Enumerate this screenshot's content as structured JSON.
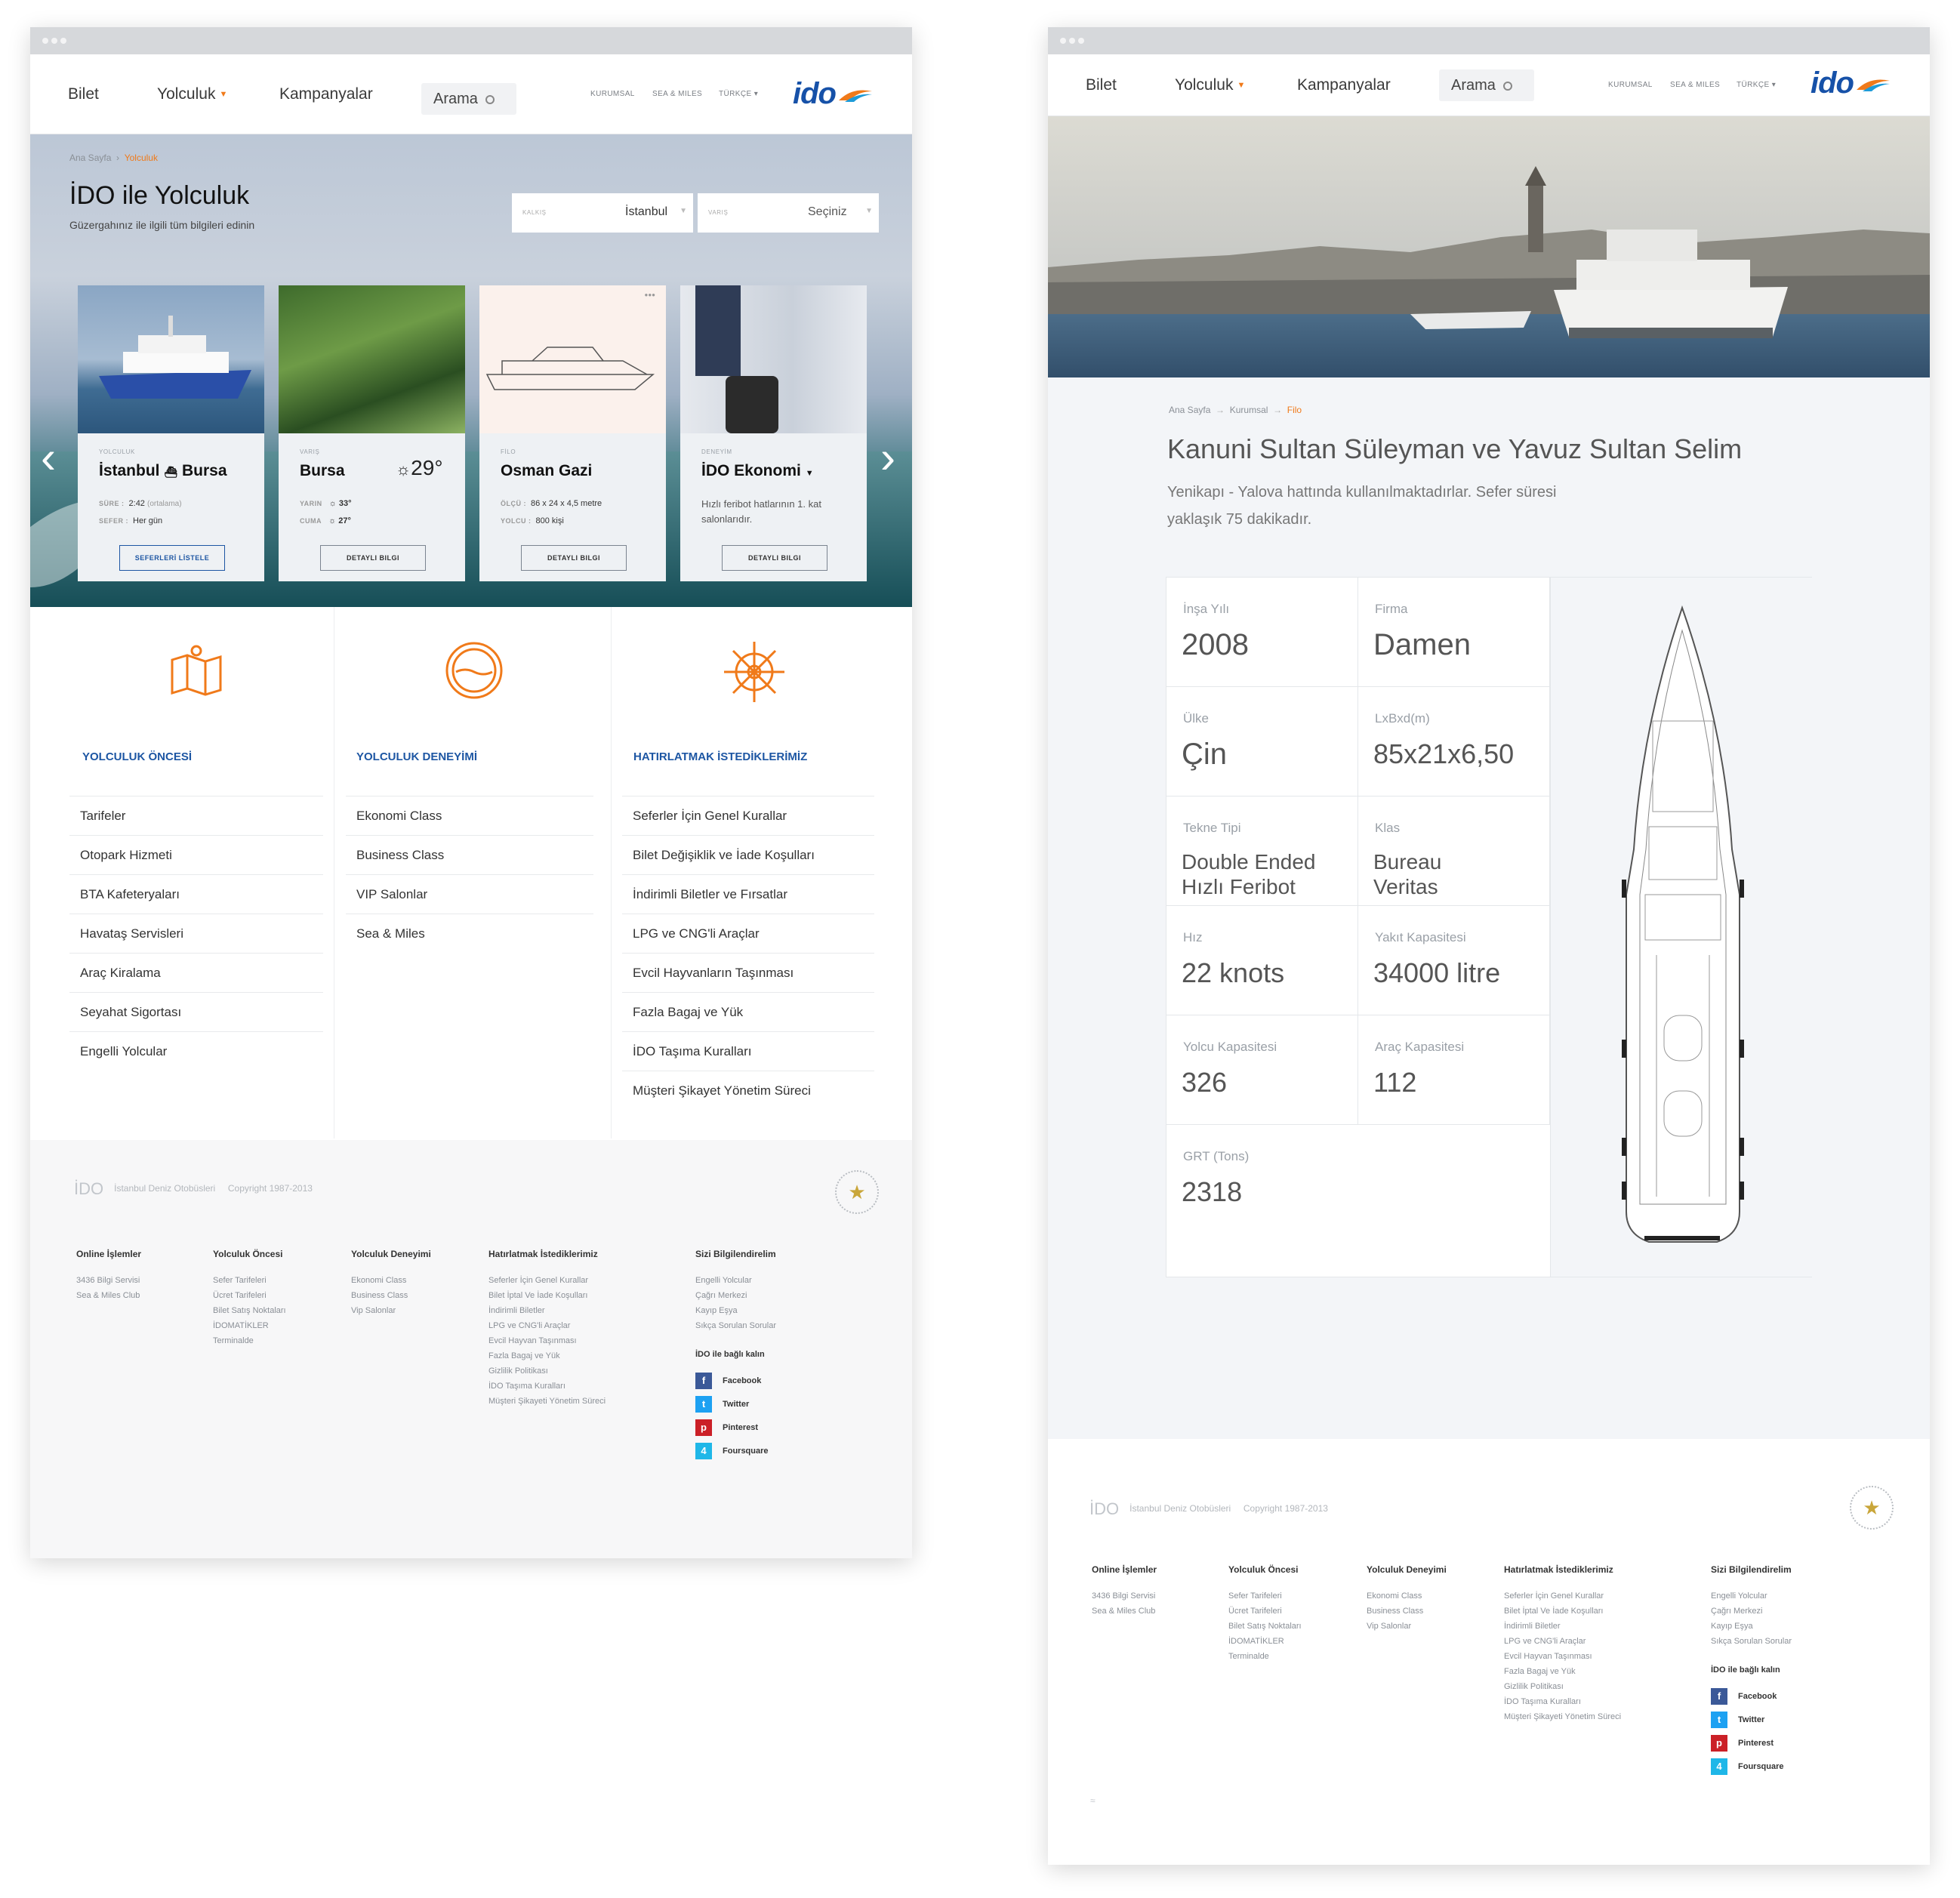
{
  "nav": {
    "bilet": "Bilet",
    "yolculuk": "Yolculuk",
    "kampanyalar": "Kampanyalar",
    "arama": "Arama",
    "kurumsal": "KURUMSAL",
    "sea_miles": "SEA & MILES",
    "turkce": "TÜRKÇE",
    "logo": "ido"
  },
  "p1": {
    "breadcrumb": [
      "Ana Sayfa",
      "Yolculuk"
    ],
    "title": "İDO ile Yolculuk",
    "subtitle": "Güzergahınız ile ilgili tüm bilgileri edinin",
    "kalkis_label": "KALKIŞ",
    "kalkis_value": "İstanbul",
    "varis_label": "VARIŞ",
    "varis_value": "Seçiniz",
    "cards": [
      {
        "label": "YOLCULUK",
        "from": "İstanbul",
        "to": "Bursa",
        "sure_k": "SÜRE :",
        "sure_v": "2:42",
        "sure_note": "(ortalama)",
        "sefer_k": "SEFER :",
        "sefer_v": "Her gün",
        "button": "SEFERLERİ LİSTELE"
      },
      {
        "label": "VARIŞ",
        "title": "Bursa",
        "temp": "29°",
        "yarin_k": "YARIN",
        "yarin_v": "33°",
        "cuma_k": "CUMA",
        "cuma_v": "27°",
        "button": "DETAYLI BILGI"
      },
      {
        "label": "FİLO",
        "title": "Osman Gazi",
        "olcu_k": "ÖLÇÜ :",
        "olcu_v": "86 x 24 x 4,5 metre",
        "yolcu_k": "YOLCU :",
        "yolcu_v": "800 kişi",
        "button": "DETAYLI BILGI"
      },
      {
        "label": "DENEYİM",
        "title": "İDO Ekonomi",
        "desc": "Hızlı feribot hatlarının 1. kat salonlarıdır.",
        "button": "DETAYLI BILGI"
      }
    ],
    "columns": [
      {
        "heading": "YOLCULUK ÖNCESİ",
        "items": [
          "Tarifeler",
          "Otopark Hizmeti",
          "BTA Kafeteryaları",
          "Havataş Servisleri",
          "Araç Kiralama",
          "Seyahat Sigortası",
          "Engelli Yolcular"
        ]
      },
      {
        "heading": "YOLCULUK DENEYİMİ",
        "items": [
          "Ekonomi Class",
          "Business Class",
          "VIP Salonlar",
          "Sea & Miles"
        ]
      },
      {
        "heading": "HATIRLATMAK İSTEDİKLERİMİZ",
        "items": [
          "Seferler İçin Genel Kurallar",
          "Bilet Değişiklik ve İade Koşulları",
          "İndirimli Biletler ve Fırsatlar",
          "LPG ve CNG'li Araçlar",
          "Evcil Hayvanların Taşınması",
          "Fazla Bagaj ve Yük",
          "İDO Taşıma Kuralları",
          "Müşteri Şikayet Yönetim Süreci"
        ]
      }
    ]
  },
  "p2": {
    "breadcrumb": [
      "Ana Sayfa",
      "Kurumsal",
      "Filo"
    ],
    "title": "Kanuni Sultan Süleyman ve Yavuz Sultan Selim",
    "desc1": "Yenikapı - Yalova hattında kullanılmaktadırlar. Sefer süresi",
    "desc2": "yaklaşık 75 dakikadır.",
    "specs": [
      {
        "k": "İnşa Yılı",
        "v": "2008"
      },
      {
        "k": "Firma",
        "v": "Damen"
      },
      {
        "k": "Ülke",
        "v": "Çin"
      },
      {
        "k": "LxBxd(m)",
        "v": "85x21x6,50"
      },
      {
        "k": "Tekne Tipi",
        "v1": "Double Ended",
        "v2": "Hızlı Feribot"
      },
      {
        "k": "Klas",
        "v1": "Bureau",
        "v2": "Veritas"
      },
      {
        "k": "Hız",
        "v": "22 knots"
      },
      {
        "k": "Yakıt Kapasitesi",
        "v": "34000 litre"
      },
      {
        "k": "Yolcu Kapasitesi",
        "v": "326"
      },
      {
        "k": "Araç Kapasitesi",
        "v": "112"
      },
      {
        "k": "GRT (Tons)",
        "v": "2318"
      }
    ]
  },
  "footer": {
    "brand": "İDO",
    "brand_sub": "İstanbul Deniz Otobüsleri",
    "copyright": "Copyright 1987-2013",
    "cols": [
      {
        "h": "Online İşlemler",
        "items": [
          "3436 Bilgi Servisi",
          "Sea & Miles Club"
        ]
      },
      {
        "h": "Yolculuk Öncesi",
        "items": [
          "Sefer Tarifeleri",
          "Ücret Tarifeleri",
          "Bilet Satış Noktaları",
          "İDOMATİKLER",
          "Terminalde"
        ]
      },
      {
        "h": "Yolculuk Deneyimi",
        "items": [
          "Ekonomi Class",
          "Business Class",
          "Vip Salonlar"
        ]
      },
      {
        "h": "Hatırlatmak İstediklerimiz",
        "items": [
          "Seferler İçin Genel Kurallar",
          "Bilet İptal Ve İade Koşulları",
          "İndirimli Biletler",
          "LPG ve CNG'li Araçlar",
          "Evcil Hayvan Taşınması",
          "Fazla Bagaj ve Yük",
          "Gizlilik Politikası",
          "İDO Taşıma Kuralları",
          "Müşteri Şikayeti Yönetim Süreci"
        ]
      },
      {
        "h": "Sizi Bilgilendirelim",
        "items": [
          "Engelli Yolcular",
          "Çağrı Merkezi",
          "Kayıp Eşya",
          "Sıkça Sorulan Sorular"
        ]
      }
    ],
    "social_h": "İDO ile bağlı kalın",
    "social": [
      "Facebook",
      "Twitter",
      "Pinterest",
      "Foursquare"
    ],
    "social_colors": [
      "#3b5998",
      "#1da1f2",
      "#cb2027",
      "#1fb7e8"
    ]
  },
  "colors": {
    "accent": "#f07a1a",
    "brand": "#1651a8",
    "heading": "#1d56a3"
  }
}
